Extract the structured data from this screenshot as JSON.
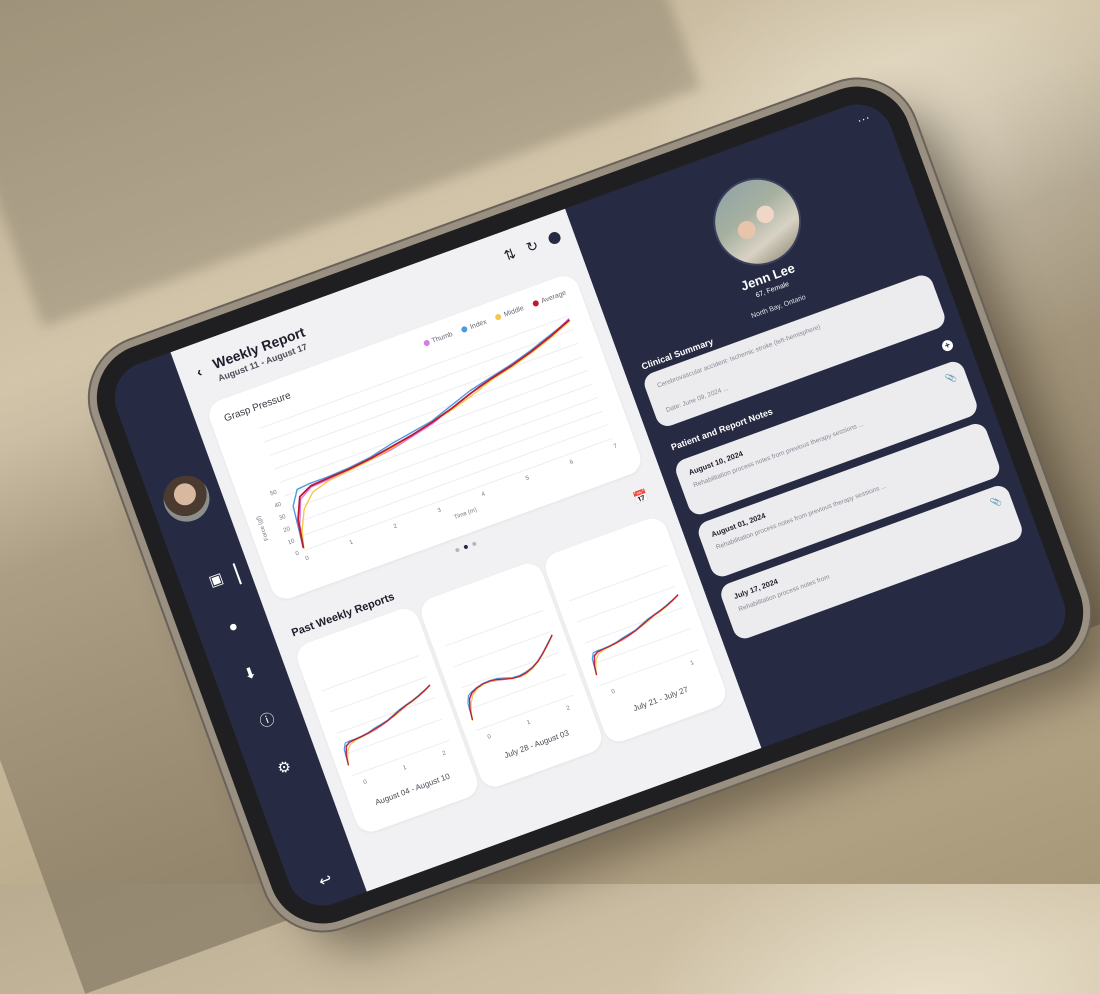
{
  "report": {
    "back_icon": "chevron-left-icon",
    "title": "Weekly Report",
    "date_range": "August 11 - August 17",
    "tools": [
      "compare-icon",
      "refresh-icon",
      "help-icon"
    ]
  },
  "grasp": {
    "title": "Grasp Pressure",
    "legend": [
      {
        "label": "Thumb",
        "color": "#d77ce6"
      },
      {
        "label": "Index",
        "color": "#4e9be0"
      },
      {
        "label": "Middle",
        "color": "#f2c94c"
      },
      {
        "label": "Average",
        "color": "#c0182e"
      }
    ]
  },
  "chart_data": {
    "type": "line",
    "title": "Grasp Pressure",
    "xlabel": "Time (m)",
    "ylabel": "Force (gf)",
    "x_ticks": [
      "0",
      "1",
      "2",
      "3",
      "4",
      "5",
      "6",
      "7"
    ],
    "y_ticks": [
      "0",
      "10",
      "20",
      "30",
      "40",
      "50"
    ],
    "xlim": [
      0,
      7
    ],
    "ylim": [
      0,
      50
    ],
    "x": [
      0,
      0.1,
      0.3,
      0.6,
      1,
      1.5,
      2,
      2.5,
      3,
      3.5,
      4,
      4.5,
      5,
      5.5,
      6,
      6.5,
      7
    ],
    "series": [
      {
        "name": "Thumb",
        "values": [
          2,
          20,
          38,
          44,
          45,
          47,
          48,
          50,
          54,
          58,
          64,
          70,
          76,
          79,
          84,
          90,
          98
        ]
      },
      {
        "name": "Index",
        "values": [
          3,
          35,
          46,
          47,
          47,
          48,
          50,
          54,
          57,
          60,
          66,
          72,
          76,
          80,
          85,
          91,
          97
        ]
      },
      {
        "name": "Middle",
        "values": [
          1,
          15,
          30,
          40,
          44,
          46,
          48,
          51,
          55,
          59,
          63,
          68,
          74,
          78,
          83,
          89,
          96
        ]
      },
      {
        "name": "Average",
        "values": [
          2,
          24,
          40,
          45,
          46,
          47,
          49,
          52,
          55,
          59,
          64,
          70,
          75,
          79,
          84,
          90,
          97
        ]
      }
    ]
  },
  "pager": {
    "count": 3,
    "active": 1
  },
  "past": {
    "title": "Past Weekly Reports",
    "calendar_icon": "calendar-icon",
    "reports": [
      {
        "label": "August 04 - August 10",
        "x_ticks": [
          "0",
          "1",
          "2"
        ]
      },
      {
        "label": "July 28 - August 03",
        "x_ticks": [
          "0",
          "1",
          "2"
        ]
      },
      {
        "label": "July 21 - July 27",
        "x_ticks": [
          "0",
          "1"
        ]
      }
    ]
  },
  "nav": {
    "items": [
      "patient-list-icon",
      "bell-icon",
      "download-icon",
      "info-icon",
      "settings-icon"
    ],
    "logout_icon": "logout-icon"
  },
  "patient": {
    "more": "...",
    "name": "Jenn Lee",
    "meta": "67, Female",
    "location": "North Bay, Ontario"
  },
  "clinical": {
    "label": "Clinical Summary",
    "text": "Cerebrovascular accident: Ischemic stroke (left-hemisphere)",
    "date": "Date: June 09, 2024 ..."
  },
  "notes": {
    "label": "Patient and Report Notes",
    "items": [
      {
        "date": "August 10, 2024",
        "text": "Rehabilitation process notes from previous therapy sessions ...",
        "attach": true
      },
      {
        "date": "August 01, 2024",
        "text": "Rehabilitation process notes from previous therapy sessions ...",
        "attach": false
      },
      {
        "date": "July 17, 2024",
        "text": "Rehabilitation process notes from",
        "attach": true
      }
    ]
  }
}
